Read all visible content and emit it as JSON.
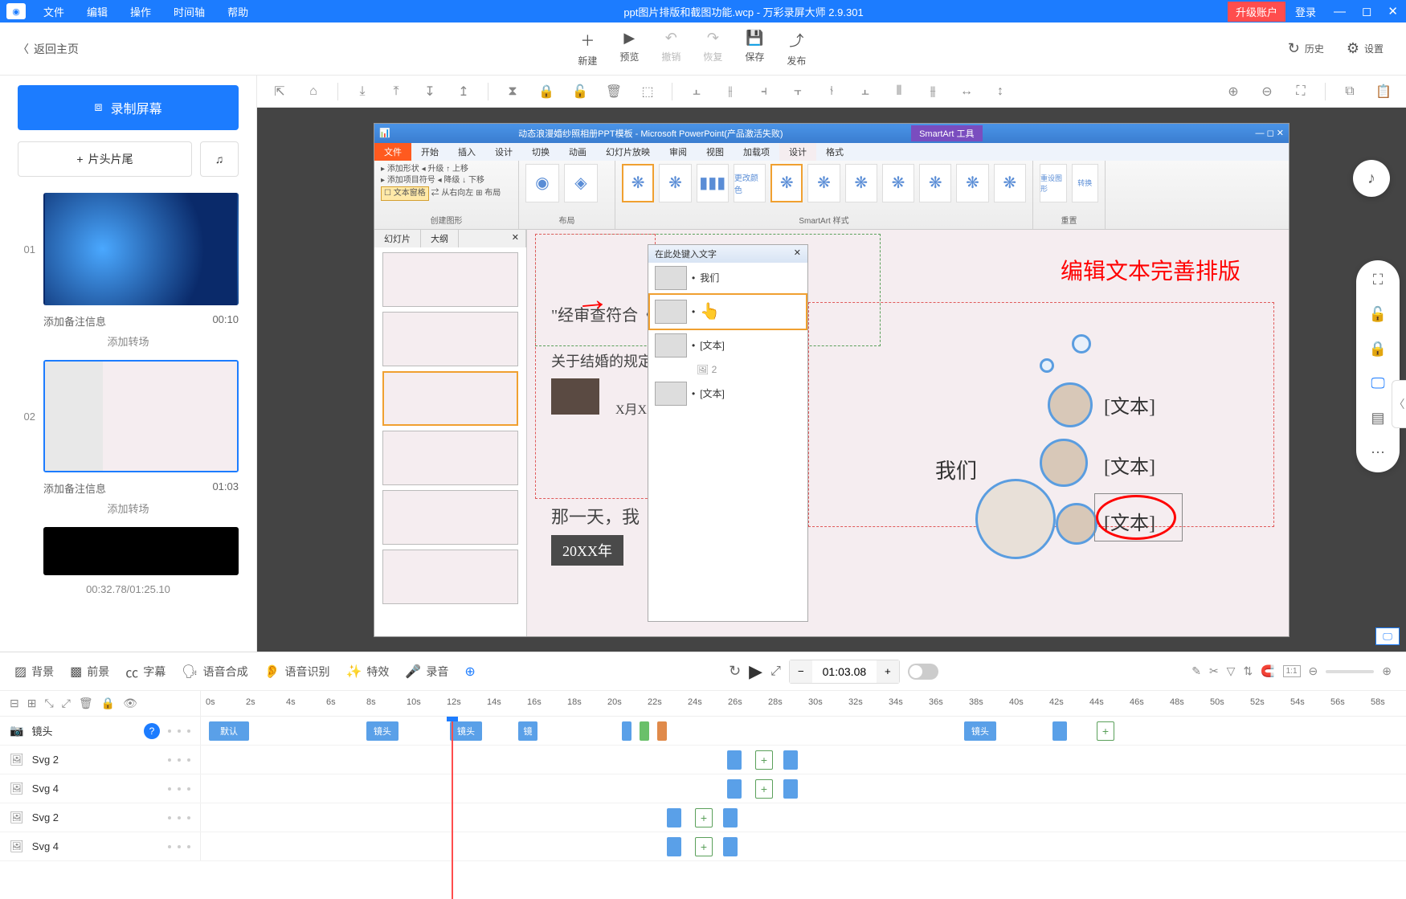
{
  "titlebar": {
    "menus": [
      "文件",
      "编辑",
      "操作",
      "时间轴",
      "帮助"
    ],
    "title": "ppt图片排版和截图功能.wcp - 万彩录屏大师 2.9.301",
    "upgrade": "升级账户",
    "login": "登录"
  },
  "toolbar": {
    "back": "返回主页",
    "buttons": [
      {
        "icon": "＋",
        "label": "新建"
      },
      {
        "icon": "▶",
        "label": "预览"
      },
      {
        "icon": "↶",
        "label": "撤销",
        "disabled": true
      },
      {
        "icon": "↷",
        "label": "恢复",
        "disabled": true
      },
      {
        "icon": "💾",
        "label": "保存"
      },
      {
        "icon": "⤴",
        "label": "发布"
      }
    ],
    "right": [
      {
        "icon": "↻",
        "label": "历史"
      },
      {
        "icon": "⚙",
        "label": "设置"
      }
    ]
  },
  "sidebar": {
    "record": "录制屏幕",
    "titleBtn": "片头片尾",
    "scenes": [
      {
        "num": "01",
        "note": "添加备注信息",
        "dur": "00:10",
        "trans": "添加转场"
      },
      {
        "num": "02",
        "note": "添加备注信息",
        "dur": "01:03",
        "trans": "添加转场"
      }
    ],
    "time": "00:32.78/01:25.10"
  },
  "timeline": {
    "tabs": [
      "背景",
      "前景",
      "字幕",
      "语音合成",
      "语音识别",
      "特效",
      "录音"
    ],
    "time": "01:03.08",
    "ticks": [
      "0s",
      "2s",
      "4s",
      "6s",
      "8s",
      "10s",
      "12s",
      "14s",
      "16s",
      "18s",
      "20s",
      "22s",
      "24s",
      "26s",
      "28s",
      "30s",
      "32s",
      "34s",
      "36s",
      "38s",
      "40s",
      "42s",
      "44s",
      "46s",
      "48s",
      "50s",
      "52s",
      "54s",
      "56s",
      "58s"
    ],
    "tracks": [
      {
        "name": "镜头",
        "help": true
      },
      {
        "name": "Svg 2"
      },
      {
        "name": "Svg 4"
      },
      {
        "name": "Svg 2"
      },
      {
        "name": "Svg 4"
      }
    ],
    "clips": {
      "default": "默认",
      "camera": "镜头",
      "cam2": "镜"
    }
  },
  "ppt": {
    "title": "动态浪漫婚纱照相册PPT模板 - Microsoft PowerPoint(产品激活失败)",
    "smartart": "SmartArt 工具",
    "tabs": [
      "文件",
      "开始",
      "插入",
      "设计",
      "切换",
      "动画",
      "幻灯片放映",
      "审阅",
      "视图",
      "加载项",
      "设计",
      "格式"
    ],
    "ribbon": {
      "group1_items": [
        "添加形状",
        "添加项目符号",
        "文本窗格",
        "升级",
        "降级",
        "从右向左",
        "上移",
        "下移",
        "布局"
      ],
      "group1_label": "创建图形",
      "group2_label": "布局",
      "group3": "更改颜色",
      "group3_label": "SmartArt 样式",
      "group4_items": [
        "重设图形",
        "转换"
      ],
      "group4_label": "重置"
    },
    "slidesTabs": [
      "幻灯片",
      "大纲"
    ],
    "textPane": {
      "title": "在此处键入文字",
      "items": [
        "我们",
        "",
        "[文本]",
        "[文本]"
      ]
    },
    "redText": "编辑文本完善排版",
    "bubbles": {
      "main": "我们",
      "t1": "[文本]",
      "t2": "[文本]",
      "t3": "[文本]"
    },
    "slideTexts": {
      "quote": "\"经审查符合《中",
      "line2": "关于结婚的规定，",
      "line3": "X月X日",
      "line4": "那一天，我",
      "year": "20XX年"
    }
  }
}
